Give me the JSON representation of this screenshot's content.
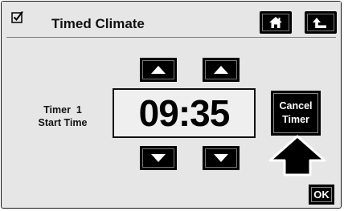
{
  "header": {
    "title": "Timed Climate",
    "home_icon": "home-icon",
    "back_icon": "return-arrow-icon",
    "check_icon": "checkbox-checked-icon"
  },
  "timer": {
    "label_line1": "Timer  1",
    "label_line2": "Start Time",
    "time": "09:35",
    "hour_up_icon": "triangle-up-icon",
    "minute_up_icon": "triangle-up-icon",
    "hour_down_icon": "triangle-down-icon",
    "minute_down_icon": "triangle-down-icon"
  },
  "actions": {
    "cancel_line1": "Cancel",
    "cancel_line2": "Timer",
    "ok_label": "OK",
    "pointer_icon": "up-arrow-pointer-icon"
  },
  "colors": {
    "background": "#e6e6e6",
    "button": "#000000",
    "button_text": "#ffffff",
    "display_bg": "#efefef"
  }
}
